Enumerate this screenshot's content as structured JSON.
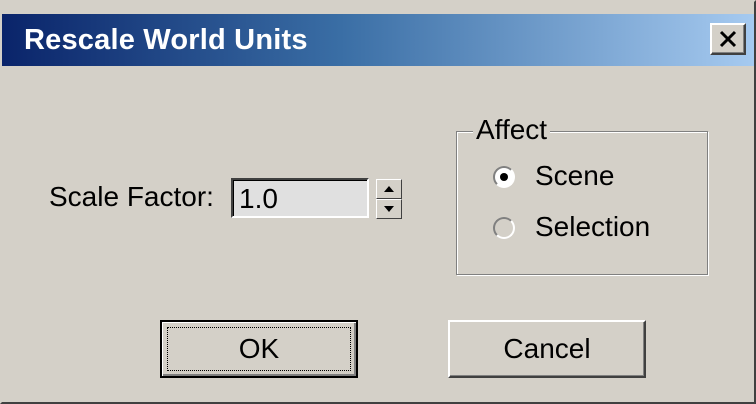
{
  "dialog": {
    "title": "Rescale World Units",
    "close_symbol": "close-icon"
  },
  "scale": {
    "label": "Scale Factor:",
    "value": "1.0",
    "spinner_icon": "up-down-arrows-icon"
  },
  "affect": {
    "group_label": "Affect",
    "options": [
      {
        "label": "Scene",
        "selected": true,
        "enabled": true
      },
      {
        "label": "Selection",
        "selected": false,
        "enabled": false
      }
    ]
  },
  "buttons": {
    "ok_label": "OK",
    "cancel_label": "Cancel"
  },
  "colors": {
    "title_gradient_start": "#0a246a",
    "title_gradient_end": "#a6caf0",
    "face": "#d4d0c8"
  }
}
